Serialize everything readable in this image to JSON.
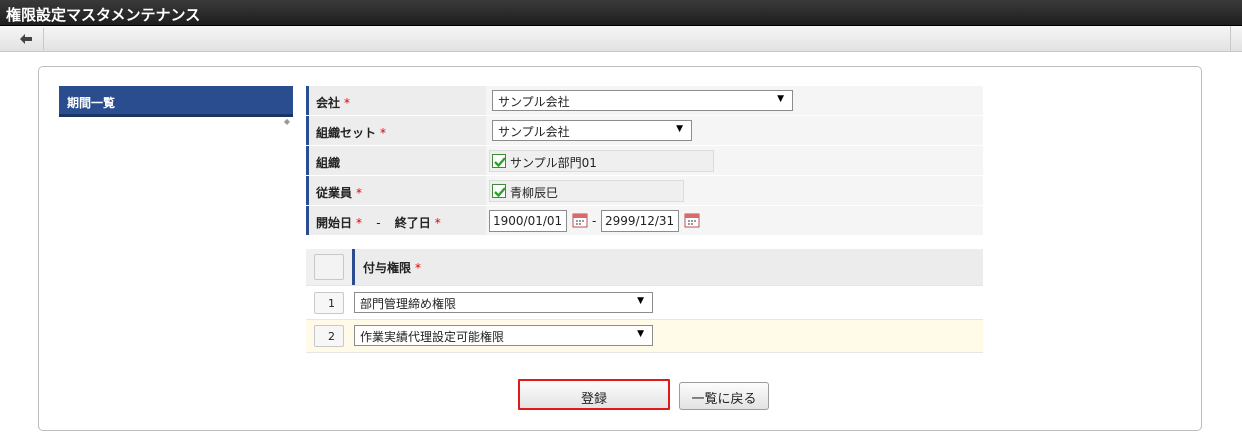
{
  "window": {
    "title": "権限設定マスタメンテナンス"
  },
  "toolbar": {
    "back_icon": "arrow-left-icon"
  },
  "sidebar": {
    "items": [
      {
        "label": "期間一覧"
      }
    ]
  },
  "form": {
    "company": {
      "label": "会社",
      "required": "*",
      "value": "サンプル会社"
    },
    "org_set": {
      "label": "組織セット",
      "required": "*",
      "value": "サンプル会社"
    },
    "org": {
      "label": "組織",
      "value": "サンプル部門01"
    },
    "employee": {
      "label": "従業員",
      "required": "*",
      "value": "青柳辰巳"
    },
    "period": {
      "start_label": "開始日",
      "start_required": "*",
      "dash": "-",
      "end_label": "終了日",
      "end_required": "*",
      "start_value": "1900/01/01",
      "separator": "-",
      "end_value": "2999/12/31"
    }
  },
  "grants": {
    "header": {
      "label": "付与権限",
      "required": "*"
    },
    "rows": [
      {
        "num": "1",
        "value": "部門管理締め権限"
      },
      {
        "num": "2",
        "value": "作業実績代理設定可能権限"
      }
    ]
  },
  "buttons": {
    "register": "登録",
    "back_to_list": "一覧に戻る"
  },
  "colors": {
    "accent": "#2a4d8f",
    "highlight_border": "#e01a1a",
    "required": "#dd0000"
  }
}
